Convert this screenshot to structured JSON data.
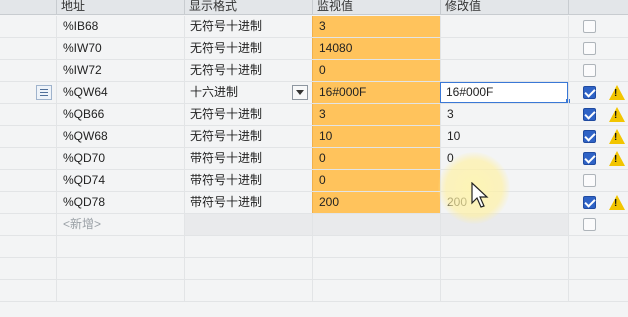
{
  "header": {
    "address": "地址",
    "display_format": "显示格式",
    "monitor_value": "监视值",
    "modify_value": "修改值"
  },
  "rows": [
    {
      "address": "%IB68",
      "format": "无符号十进制",
      "monitor": "3",
      "modify": "",
      "checked": false,
      "warn": false
    },
    {
      "address": "%IW70",
      "format": "无符号十进制",
      "monitor": "14080",
      "modify": "",
      "checked": false,
      "warn": false
    },
    {
      "address": "%IW72",
      "format": "无符号十进制",
      "monitor": "0",
      "modify": "",
      "checked": false,
      "warn": false
    },
    {
      "address": "%QW64",
      "format": "十六进制",
      "monitor": "16#000F",
      "modify": "16#000F",
      "checked": true,
      "warn": true
    },
    {
      "address": "%QB66",
      "format": "无符号十进制",
      "monitor": "3",
      "modify": "3",
      "checked": true,
      "warn": true
    },
    {
      "address": "%QW68",
      "format": "无符号十进制",
      "monitor": "10",
      "modify": "10",
      "checked": true,
      "warn": true
    },
    {
      "address": "%QD70",
      "format": "带符号十进制",
      "monitor": "0",
      "modify": "0",
      "checked": true,
      "warn": true
    },
    {
      "address": "%QD74",
      "format": "带符号十进制",
      "monitor": "0",
      "modify": "",
      "checked": false,
      "warn": false
    },
    {
      "address": "%QD78",
      "format": "带符号十进制",
      "monitor": "200",
      "modify": "200",
      "checked": true,
      "warn": true
    }
  ],
  "new_row_placeholder": "<新增>",
  "icons": {
    "lightning": "lightning-icon",
    "warning": "warning-icon",
    "row_marker": "row-detail-icon",
    "dropdown": "dropdown-arrow-icon",
    "cursor": "mouse-cursor-icon"
  },
  "colors": {
    "monitor_bg": "#ffc35c",
    "checkbox_checked": "#2f63c6",
    "warning": "#f2c500",
    "focus_border": "#3a78d6"
  }
}
